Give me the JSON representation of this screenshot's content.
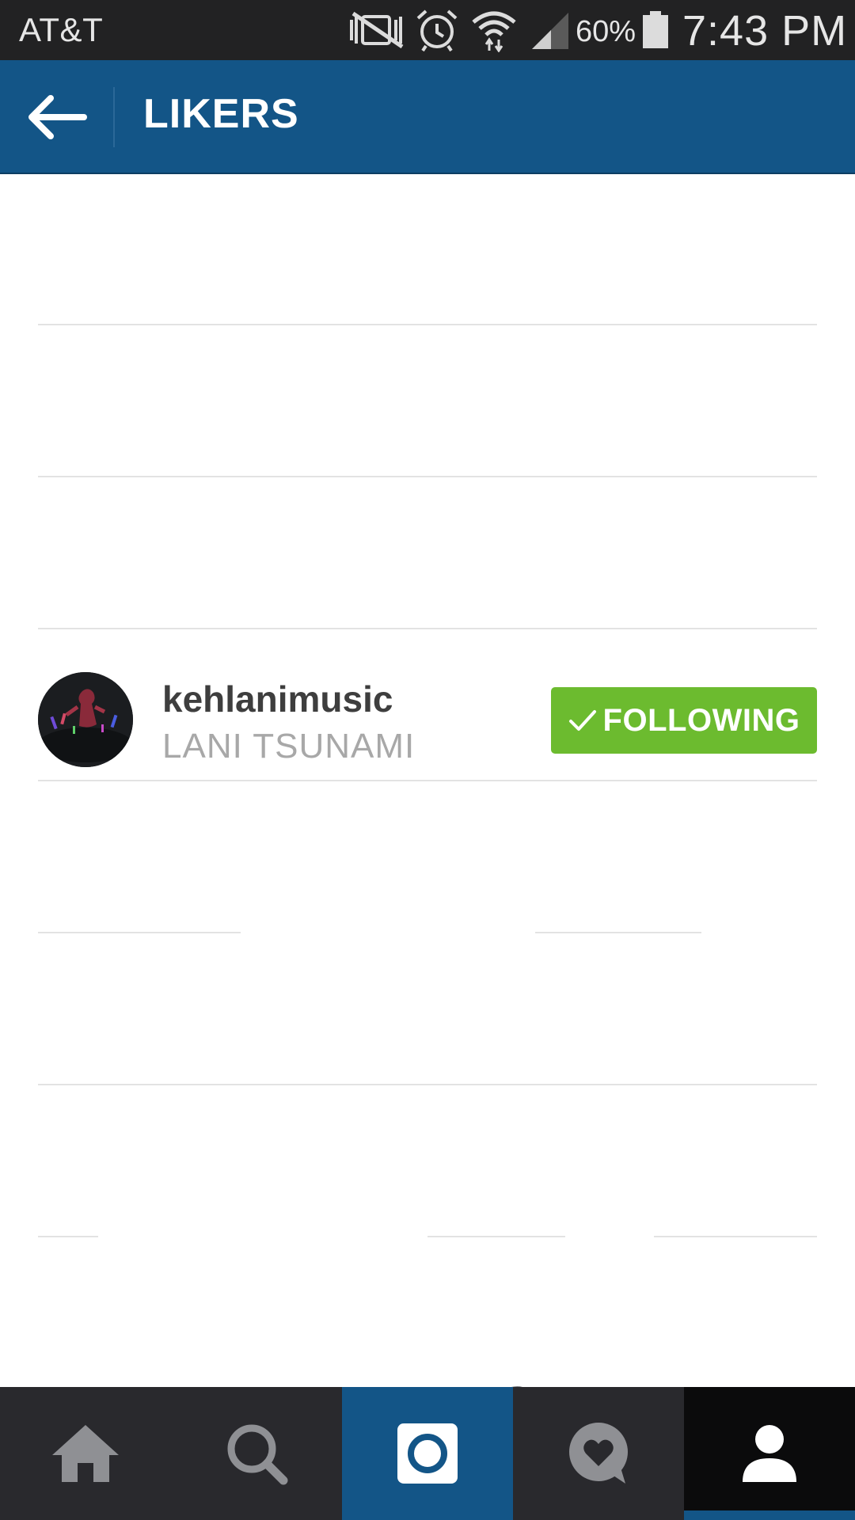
{
  "status_bar": {
    "carrier": "AT&T",
    "battery_percent": "60%",
    "time": "7:43 PM",
    "icons": [
      "vibrate-off-icon",
      "alarm-icon",
      "wifi-icon",
      "signal-icon",
      "battery-icon"
    ]
  },
  "header": {
    "back_icon": "arrow-left-icon",
    "title": "LIKERS"
  },
  "likers": [
    {
      "username": "kehlanimusic",
      "full_name": "LANI TSUNAMI",
      "follow_label": "FOLLOWING",
      "follow_icon": "check-icon",
      "follow_color": "#6cbb2f"
    }
  ],
  "tab_bar": {
    "tabs": [
      {
        "name": "home",
        "icon": "home-icon"
      },
      {
        "name": "search",
        "icon": "search-icon"
      },
      {
        "name": "camera",
        "icon": "camera-icon"
      },
      {
        "name": "activity",
        "icon": "heart-bubble-icon"
      },
      {
        "name": "profile",
        "icon": "person-icon",
        "active": true
      }
    ]
  },
  "colors": {
    "header": "#135587",
    "status_bar": "#222223",
    "tab_bar": "#29292d",
    "following_button": "#6cbb2f"
  }
}
